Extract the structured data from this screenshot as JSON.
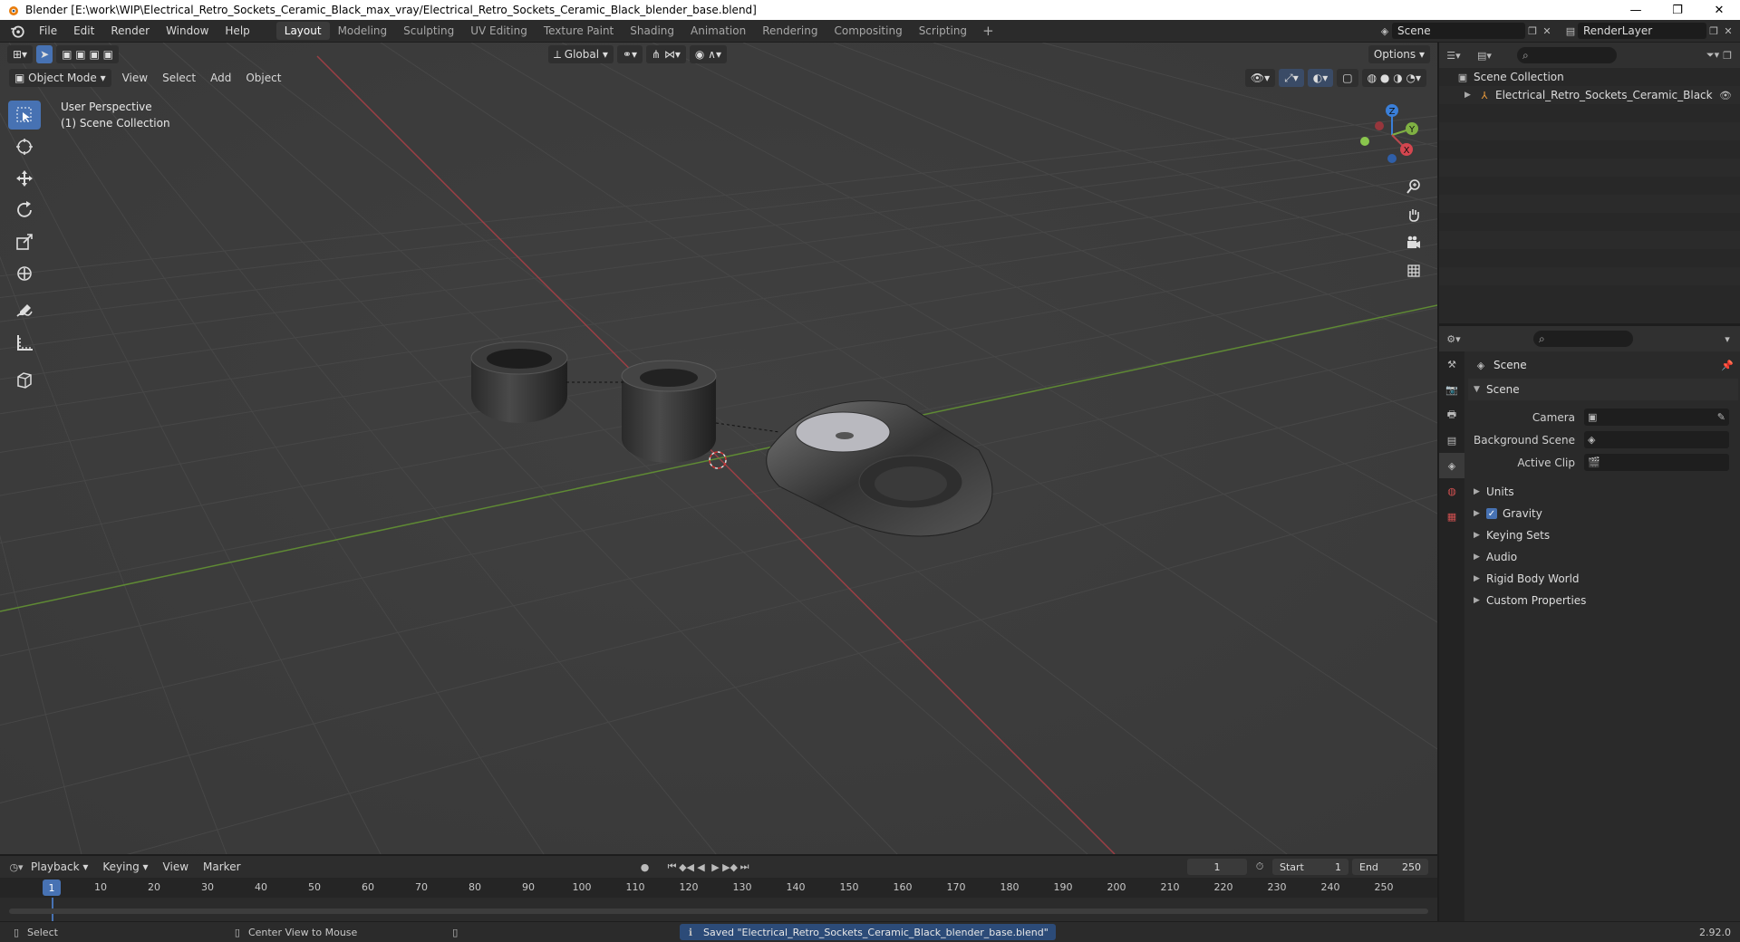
{
  "window": {
    "title": "Blender [E:\\work\\WIP\\Electrical_Retro_Sockets_Ceramic_Black_max_vray/Electrical_Retro_Sockets_Ceramic_Black_blender_base.blend]",
    "minimize": "—",
    "restore": "❐",
    "close": "✕"
  },
  "menu": {
    "file": "File",
    "edit": "Edit",
    "render": "Render",
    "window": "Window",
    "help": "Help"
  },
  "workspaces": [
    "Layout",
    "Modeling",
    "Sculpting",
    "UV Editing",
    "Texture Paint",
    "Shading",
    "Animation",
    "Rendering",
    "Compositing",
    "Scripting"
  ],
  "active_workspace": "Layout",
  "scene_field": "Scene",
  "renderlayer_field": "RenderLayer",
  "viewport": {
    "transform_orientation": "Global",
    "options": "Options",
    "mode": "Object Mode",
    "menus": {
      "view": "View",
      "select": "Select",
      "add": "Add",
      "object": "Object"
    },
    "info_line1": "User Perspective",
    "info_line2": "(1) Scene Collection",
    "gizmo": {
      "x": "X",
      "y": "Y",
      "z": "Z"
    }
  },
  "outliner": {
    "root": "Scene Collection",
    "items": [
      "Electrical_Retro_Sockets_Ceramic_Black"
    ]
  },
  "properties": {
    "title": "Scene",
    "panel": "Scene",
    "fields": [
      {
        "label": "Camera"
      },
      {
        "label": "Background Scene"
      },
      {
        "label": "Active Clip"
      }
    ],
    "subpanels": [
      "Units",
      "Gravity",
      "Keying Sets",
      "Audio",
      "Rigid Body World",
      "Custom Properties"
    ]
  },
  "timeline": {
    "menus": {
      "playback": "Playback",
      "keying": "Keying",
      "view": "View",
      "marker": "Marker"
    },
    "current_frame": "1",
    "start_label": "Start",
    "start": "1",
    "end_label": "End",
    "end": "250",
    "ruler": [
      "1",
      "10",
      "20",
      "30",
      "40",
      "50",
      "60",
      "70",
      "80",
      "90",
      "100",
      "110",
      "120",
      "130",
      "140",
      "150",
      "160",
      "170",
      "180",
      "190",
      "200",
      "210",
      "220",
      "230",
      "240",
      "250"
    ]
  },
  "statusbar": {
    "select": "Select",
    "center_view": "Center View to Mouse",
    "message": "Saved \"Electrical_Retro_Sockets_Ceramic_Black_blender_base.blend\"",
    "version": "2.92.0"
  },
  "colors": {
    "accent": "#4772b3",
    "x_axis": "#b9484e",
    "y_axis": "#7fb043",
    "z_axis": "#3a7fd9"
  }
}
